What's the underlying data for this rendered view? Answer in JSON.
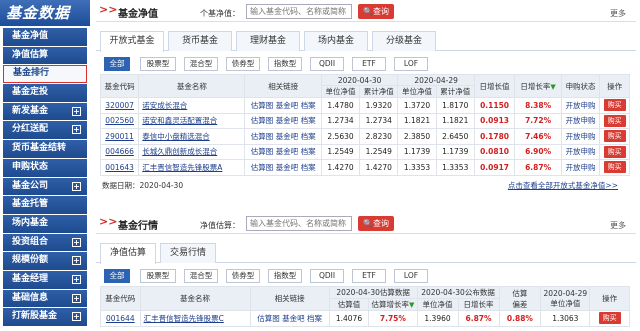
{
  "logo": "基金数据",
  "sidebar": {
    "items": [
      {
        "label": "基金净值",
        "plus": false,
        "active": false
      },
      {
        "label": "净值估算",
        "plus": false,
        "active": false
      },
      {
        "label": "基金排行",
        "plus": false,
        "active": true
      },
      {
        "label": "基金定投",
        "plus": false,
        "active": false
      },
      {
        "label": "新发基金",
        "plus": true,
        "active": false
      },
      {
        "label": "分红送配",
        "plus": true,
        "active": false
      },
      {
        "label": "货币基金结转",
        "plus": false,
        "active": false
      },
      {
        "label": "申购状态",
        "plus": false,
        "active": false
      },
      {
        "label": "基金公司",
        "plus": true,
        "active": false
      },
      {
        "label": "基金托管",
        "plus": false,
        "active": false
      },
      {
        "label": "场内基金",
        "plus": false,
        "active": false
      },
      {
        "label": "投资组合",
        "plus": true,
        "active": false
      },
      {
        "label": "规模份额",
        "plus": true,
        "active": false
      },
      {
        "label": "基金经理",
        "plus": true,
        "active": false
      },
      {
        "label": "基础信息",
        "plus": true,
        "active": false
      },
      {
        "label": "打新股基金",
        "plus": true,
        "active": false
      }
    ]
  },
  "nav_section": {
    "arrow": ">>",
    "title": "基金净值",
    "search_label": "个基净值：",
    "search_placeholder": "输入基金代码、名称或简称",
    "search_button": "查询",
    "more": "更多",
    "tabs": [
      "开放式基金",
      "货币基金",
      "理财基金",
      "场内基金",
      "分级基金"
    ],
    "filters": [
      "全部",
      "股票型",
      "混合型",
      "债券型",
      "指数型",
      "QDII",
      "ETF",
      "LOF"
    ],
    "headers": {
      "code": "基金代码",
      "name": "基金名称",
      "links": "相关链接",
      "date1": "2020-04-30",
      "date2": "2020-04-29",
      "unit_nav": "单位净值",
      "cum_nav": "累计净值",
      "unit_nav2": "单位净值",
      "cum_nav2": "累计净值",
      "day_growth": "日增长值",
      "day_rate": "日增长率",
      "status": "申购状态",
      "op": "操作"
    },
    "rows": [
      {
        "code": "320007",
        "name": "诺安成长混合",
        "l1": "估算图",
        "l2": "基金吧",
        "l3": "档案",
        "n1": "1.4780",
        "c1": "1.9320",
        "n2": "1.3720",
        "c2": "1.8170",
        "dv": "0.1150",
        "dr": "8.38%",
        "st": "开放申购",
        "op": "购买"
      },
      {
        "code": "002560",
        "name": "诺安和鑫灵活配置混合",
        "l1": "估算图",
        "l2": "基金吧",
        "l3": "档案",
        "n1": "1.2734",
        "c1": "1.2734",
        "n2": "1.1821",
        "c2": "1.1821",
        "dv": "0.0913",
        "dr": "7.72%",
        "st": "开放申购",
        "op": "购买"
      },
      {
        "code": "290011",
        "name": "泰信中小盘精选混合",
        "l1": "估算图",
        "l2": "基金吧",
        "l3": "档案",
        "n1": "2.5630",
        "c1": "2.8230",
        "n2": "2.3850",
        "c2": "2.6450",
        "dv": "0.1780",
        "dr": "7.46%",
        "st": "开放申购",
        "op": "购买"
      },
      {
        "code": "004666",
        "name": "长城久鼎创新成长混合",
        "l1": "估算图",
        "l2": "基金吧",
        "l3": "档案",
        "n1": "1.2549",
        "c1": "1.2549",
        "n2": "1.1739",
        "c2": "1.1739",
        "dv": "0.0810",
        "dr": "6.90%",
        "st": "开放申购",
        "op": "购买"
      },
      {
        "code": "001643",
        "name": "汇丰晋信智造先锋股票A",
        "l1": "估算图",
        "l2": "基金吧",
        "l3": "档案",
        "n1": "1.4270",
        "c1": "1.4270",
        "n2": "1.3353",
        "c2": "1.3353",
        "dv": "0.0917",
        "dr": "6.87%",
        "st": "开放申购",
        "op": "购买"
      }
    ],
    "date_line": "数据日期：2020-04-30",
    "all_link": "点击查看全部开放式基金净值>>"
  },
  "quote_section": {
    "arrow": ">>",
    "title": "基金行情",
    "search_label": "净值估算：",
    "search_placeholder": "输入基金代码、名称或简称",
    "search_button": "查询",
    "more": "更多",
    "tabs": [
      "净值估算",
      "交易行情"
    ],
    "filters": [
      "全部",
      "股票型",
      "混合型",
      "债券型",
      "指数型",
      "QDII",
      "ETF",
      "LOF"
    ],
    "headers": {
      "code": "基金代码",
      "name": "基金名称",
      "links": "相关链接",
      "est_group": "2020-04-30估算数据",
      "pub_group": "2020-04-30公布数据",
      "est_dev": "估算",
      "est_dev2": "偏差",
      "prev_date": "2020-04-29",
      "prev_nav": "单位净值",
      "op": "操作",
      "est_val": "估算值",
      "est_rate": "估算增长率",
      "unit_nav": "单位净值",
      "day_rate": "日增长率"
    },
    "rows": [
      {
        "code": "001644",
        "name": "汇丰晋信智造先锋股票C",
        "l1": "估算图",
        "l2": "基金吧",
        "l3": "档案",
        "ev": "1.4076",
        "er": "7.75%",
        "un": "1.3960",
        "dr": "6.87%",
        "dev": "0.88%",
        "pn": "1.3063",
        "op": "购买"
      }
    ]
  }
}
